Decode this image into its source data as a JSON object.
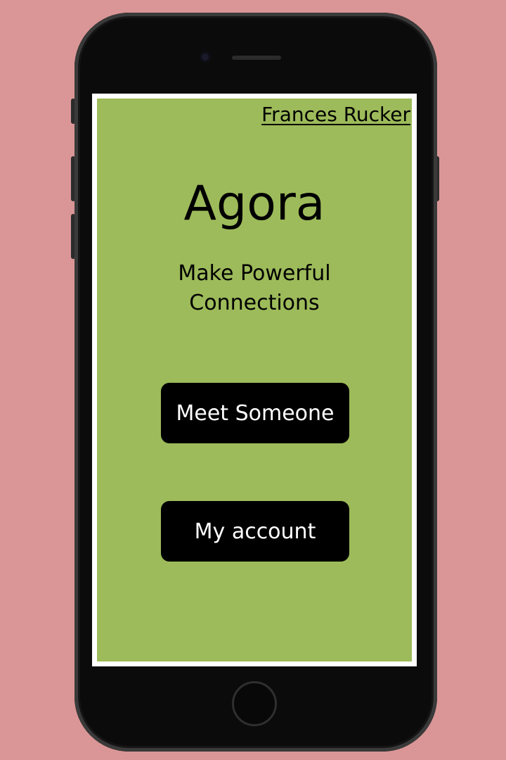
{
  "header": {
    "user_name": "Frances Rucker"
  },
  "main": {
    "app_title": "Agora",
    "tagline_line1": "Make Powerful",
    "tagline_line2": "Connections"
  },
  "actions": {
    "meet_label": "Meet Someone",
    "account_label": "My account"
  },
  "colors": {
    "background": "#da9696",
    "screen": "#9dbb5a",
    "button": "#000000",
    "button_text": "#ffffff"
  }
}
